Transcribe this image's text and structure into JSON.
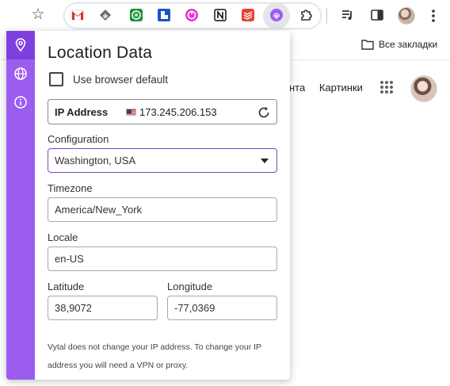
{
  "browser": {
    "extension_icons": [
      "gmail-icon",
      "feedly-icon",
      "green-extension-icon",
      "blue-extension-icon",
      "pink-power-icon",
      "notion-icon",
      "todoist-icon",
      "vytal-fingerprint-icon"
    ],
    "bookmarks_label": "Все закладки"
  },
  "page": {
    "links": [
      "нта",
      "Картинки"
    ]
  },
  "popup": {
    "accent_color": "#9c5cf0",
    "rail_icons": [
      "location-pin-icon",
      "globe-icon",
      "info-icon"
    ],
    "title": "Location Data",
    "use_browser_default_label": "Use browser default",
    "ip_label": "IP Address",
    "ip_value": "173.245.206.153",
    "configuration_label": "Configuration",
    "configuration_value": "Washington, USA",
    "timezone_label": "Timezone",
    "timezone_value": "America/New_York",
    "locale_label": "Locale",
    "locale_value": "en-US",
    "latitude_label": "Latitude",
    "latitude_value": "38,9072",
    "longitude_label": "Longitude",
    "longitude_value": "-77,0369",
    "note": "Vytal does not change your IP address. To change your IP address you will need a VPN or proxy."
  }
}
